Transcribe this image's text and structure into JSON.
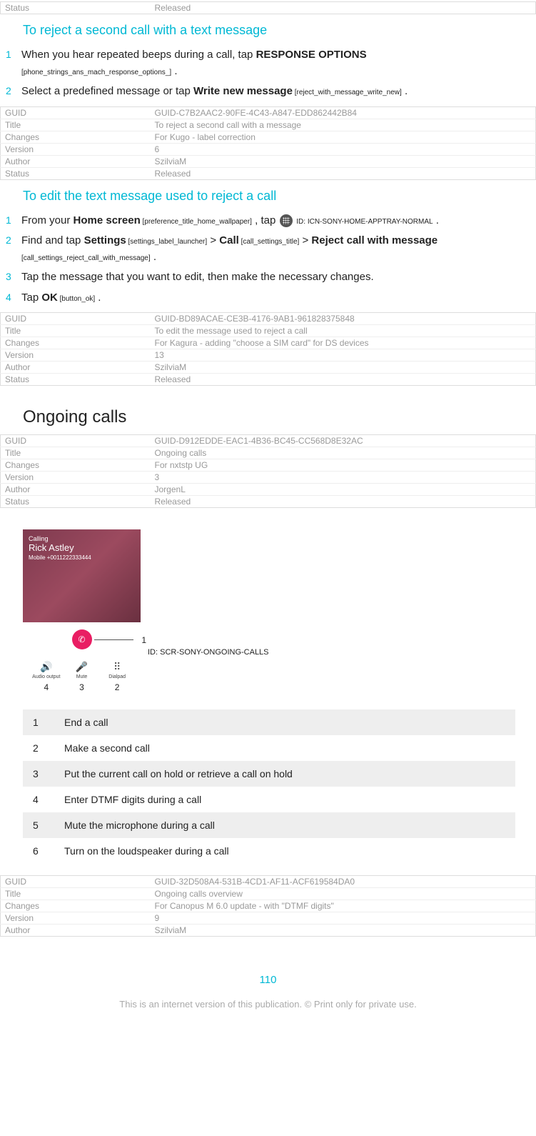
{
  "top_row": {
    "status_label": "Status",
    "status_value": "Released"
  },
  "section1": {
    "heading": "To reject a second call with a text message",
    "step1_prefix": "When you hear repeated beeps during a call, tap ",
    "step1_strong": "RESPONSE OPTIONS",
    "step1_ref": "[phone_strings_ans_mach_response_options_]",
    "step1_suffix": " .",
    "step2_a": "Select a predefined message or tap ",
    "step2_strong": "Write new message",
    "step2_ref": " [reject_with_message_write_new]",
    "step2_suffix": " ."
  },
  "meta1": {
    "guid": "GUID-C7B2AAC2-90FE-4C43-A847-EDD862442B84",
    "title": "To reject a second call with a message",
    "changes": "For Kugo - label correction",
    "version": "6",
    "author": "SzilviaM",
    "status": "Released"
  },
  "section2": {
    "heading": "To edit the text message used to reject a call",
    "s1_a": "From your ",
    "s1_strong1": "Home screen",
    "s1_ref1": " [preference_title_home_wallpaper]",
    "s1_mid": " , tap ",
    "s1_icon_id": " ID: ICN-SONY-HOME-APPTRAY-NORMAL",
    "s1_suffix": " .",
    "s2_a": "Find and tap ",
    "s2_strong1": "Settings",
    "s2_ref1": " [settings_label_launcher]",
    "s2_gt1": " > ",
    "s2_strong2": "Call",
    "s2_ref2": " [call_settings_title]",
    "s2_gt2": " > ",
    "s2_strong3": "Reject call with message",
    "s2_ref3": " [call_settings_reject_call_with_message]",
    "s2_suffix": " .",
    "s3": "Tap the message that you want to edit, then make the necessary changes.",
    "s4_a": "Tap ",
    "s4_strong": "OK",
    "s4_ref": " [button_ok]",
    "s4_suffix": " ."
  },
  "meta2": {
    "guid": "GUID-BD89ACAE-CE3B-4176-9AB1-961828375848",
    "title": "To edit the message used to reject a call",
    "changes": "For Kagura - adding \"choose a SIM card\" for DS devices",
    "version": "13",
    "author": "SzilviaM",
    "status": "Released"
  },
  "ongoing_heading": "Ongoing calls",
  "meta3": {
    "guid": "GUID-D912EDDE-EAC1-4B36-BC45-CC568D8E32AC",
    "title": "Ongoing calls",
    "changes": "For nxtstp UG",
    "version": "3",
    "author": "JorgenL",
    "status": "Released"
  },
  "phone": {
    "calling": "Calling",
    "name": "Rick Astley",
    "mobile": "Mobile +0011222333444",
    "callout_end": "1",
    "btn1_label": "Audio output",
    "btn1_ic": "🔊",
    "btn2_label": "Mute",
    "btn2_ic": "🎤",
    "btn3_label": "Dialpad",
    "btn3_ic": "⠿",
    "num4": "4",
    "num3": "3",
    "num2": "2",
    "image_id": "ID: SCR-SONY-ONGOING-CALLS"
  },
  "callouts": [
    {
      "n": "1",
      "t": "End a call"
    },
    {
      "n": "2",
      "t": "Make a second call"
    },
    {
      "n": "3",
      "t": "Put the current call on hold or retrieve a call on hold"
    },
    {
      "n": "4",
      "t": "Enter DTMF digits during a call"
    },
    {
      "n": "5",
      "t": "Mute the microphone during a call"
    },
    {
      "n": "6",
      "t": "Turn on the loudspeaker during a call"
    }
  ],
  "meta4": {
    "guid": "GUID-32D508A4-531B-4CD1-AF11-ACF619584DA0",
    "title": "Ongoing calls overview",
    "changes": "For Canopus M 6.0 update - with \"DTMF digits\"",
    "version": "9",
    "author": "SzilviaM"
  },
  "labels": {
    "guid": "GUID",
    "title": "Title",
    "changes": "Changes",
    "version": "Version",
    "author": "Author",
    "status": "Status"
  },
  "page_number": "110",
  "footer": "This is an internet version of this publication. © Print only for private use."
}
